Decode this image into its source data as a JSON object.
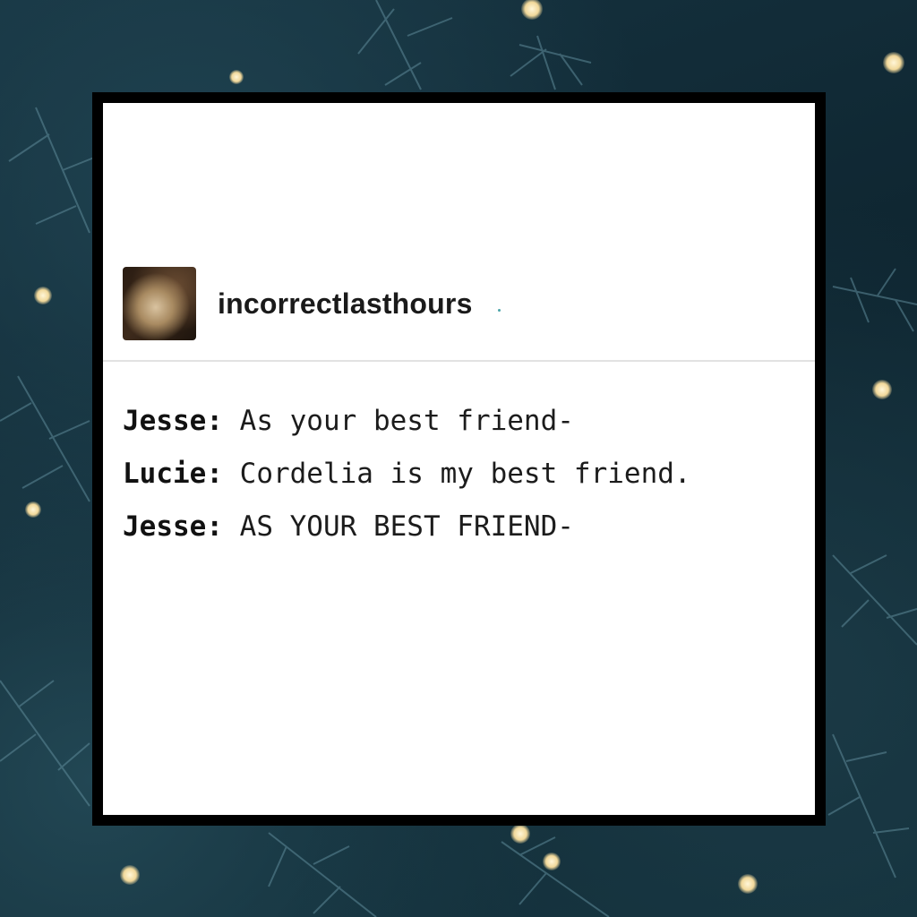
{
  "post": {
    "username": "incorrectlasthours",
    "avatar_icon": "blog-avatar"
  },
  "dialogue": [
    {
      "speaker": "Jesse:",
      "text": "As your best friend-"
    },
    {
      "speaker": "Lucie:",
      "text": "Cordelia is my best friend."
    },
    {
      "speaker": "Jesse:",
      "text": "AS YOUR BEST FRIEND-"
    }
  ],
  "colors": {
    "background": "#0f2630",
    "frame": "#000000",
    "card": "#ffffff",
    "text": "#1c1c1c",
    "light": "#f1d89a"
  }
}
